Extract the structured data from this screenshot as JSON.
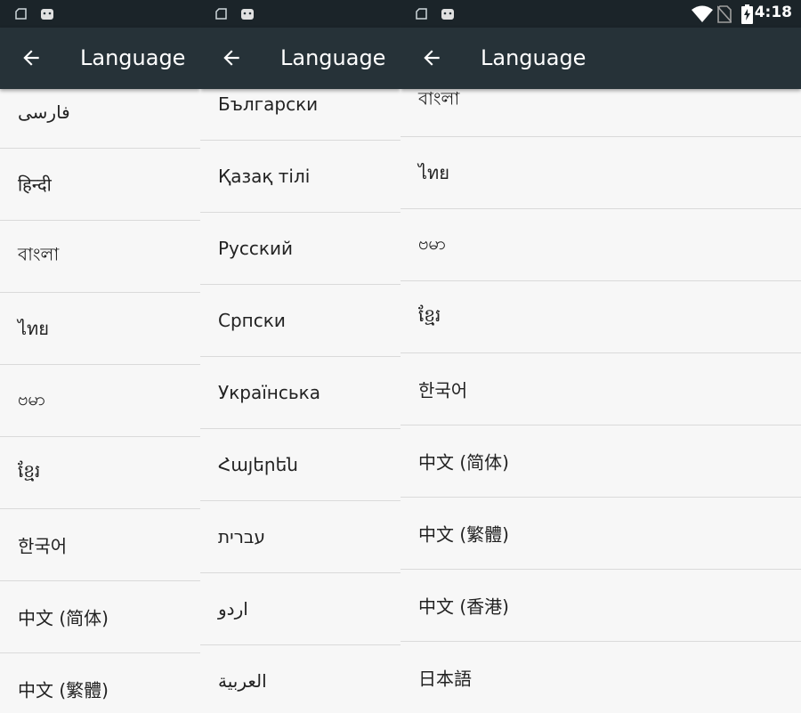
{
  "status_bar": {
    "time": "4:18"
  },
  "app_bar": {
    "title": "Language"
  },
  "panels": [
    {
      "items": [
        "فارسی",
        "हिन्दी",
        "বাংলা",
        "ไทย",
        "ဗမာ",
        "ខ្មែរ",
        "한국어",
        "中文 (简体)",
        "中文 (繁體)"
      ]
    },
    {
      "items": [
        "Български",
        "Қазақ тілі",
        "Русский",
        "Српски",
        "Українська",
        "Հայերեն",
        "עברית",
        "اردو",
        "العربية"
      ]
    },
    {
      "items": [
        "বাংলা",
        "ไทย",
        "ဗမာ",
        "ខ្មែរ",
        "한국어",
        "中文 (简体)",
        "中文 (繁體)",
        "中文 (香港)",
        "日本語"
      ]
    }
  ]
}
